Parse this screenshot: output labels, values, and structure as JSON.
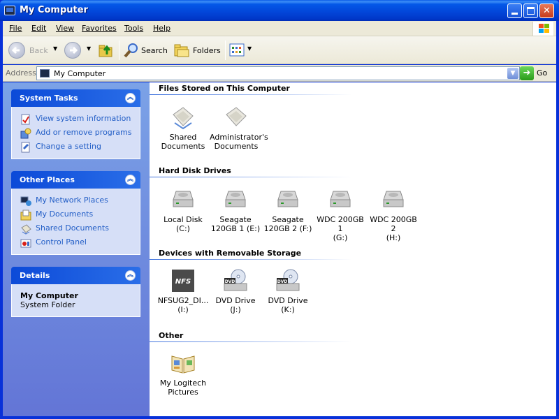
{
  "window": {
    "title": "My Computer"
  },
  "menu": [
    "File",
    "Edit",
    "View",
    "Favorites",
    "Tools",
    "Help"
  ],
  "toolbar": {
    "back": "Back",
    "search": "Search",
    "folders": "Folders"
  },
  "address": {
    "label": "Address",
    "value": "My Computer",
    "go": "Go"
  },
  "left": {
    "system_tasks": {
      "title": "System Tasks",
      "items": [
        "View system information",
        "Add or remove programs",
        "Change a setting"
      ]
    },
    "other_places": {
      "title": "Other Places",
      "items": [
        "My Network Places",
        "My Documents",
        "Shared Documents",
        "Control Panel"
      ]
    },
    "details": {
      "title": "Details",
      "name": "My Computer",
      "type": "System Folder"
    }
  },
  "groups": {
    "files": {
      "title": "Files Stored on This Computer",
      "items": [
        {
          "line1": "Shared",
          "line2": "Documents"
        },
        {
          "line1": "Administrator's",
          "line2": "Documents"
        }
      ]
    },
    "hdd": {
      "title": "Hard Disk Drives",
      "items": [
        {
          "line1": "Local Disk (C:)",
          "line2": ""
        },
        {
          "line1": "Seagate",
          "line2": "120GB 1 (E:)"
        },
        {
          "line1": "Seagate",
          "line2": "120GB 2 (F:)"
        },
        {
          "line1": "WDC 200GB 1",
          "line2": "(G:)"
        },
        {
          "line1": "WDC 200GB 2",
          "line2": "(H:)"
        }
      ]
    },
    "removable": {
      "title": "Devices with Removable Storage",
      "items": [
        {
          "line1": "NFSUG2_DI...",
          "line2": "(I:)",
          "badge": "NFS"
        },
        {
          "line1": "DVD Drive (J:)",
          "line2": "",
          "badge": "DVD"
        },
        {
          "line1": "DVD Drive (K:)",
          "line2": "",
          "badge": "DVD"
        }
      ]
    },
    "other": {
      "title": "Other",
      "items": [
        {
          "line1": "My Logitech",
          "line2": "Pictures"
        }
      ]
    }
  },
  "icons": {
    "title": "my-computer-icon",
    "minimize": "minimize-icon",
    "maximize": "maximize-icon",
    "close": "close-icon",
    "back": "back-arrow-icon",
    "forward": "forward-arrow-icon",
    "up": "up-folder-icon",
    "search": "search-icon",
    "folders": "folders-icon",
    "views": "views-icon",
    "go": "go-arrow-icon"
  },
  "colors": {
    "titlebar": "#0245d8",
    "taskpane_bg": "#6375d6",
    "link": "#215dc6",
    "close_button": "#c73a1a"
  }
}
